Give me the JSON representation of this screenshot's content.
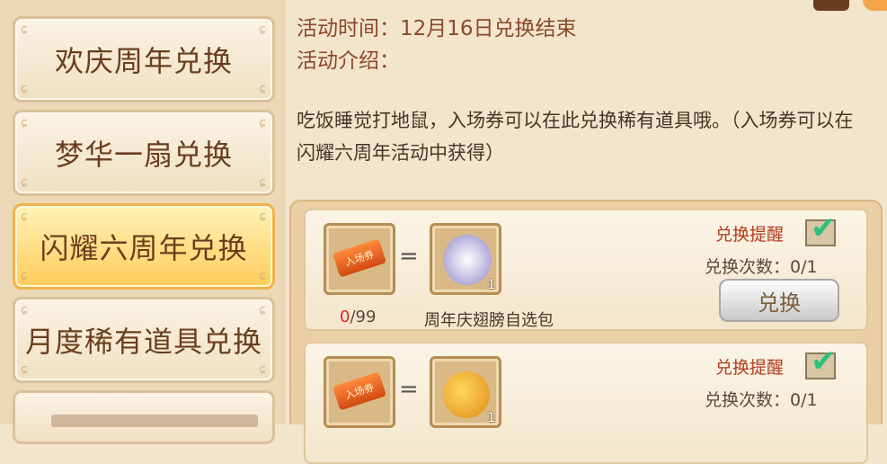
{
  "tabs": [
    {
      "label": "欢庆周年兑换",
      "active": false
    },
    {
      "label": "梦华一扇兑换",
      "active": false
    },
    {
      "label": "闪耀六周年兑换",
      "active": true
    },
    {
      "label": "月度稀有道具兑换",
      "active": false
    }
  ],
  "activity": {
    "time_label": "活动时间：12月16日兑换结束",
    "intro_label": "活动介绍：",
    "description": "吃饭睡觉打地鼠，入场券可以在此兑换稀有道具哦。（入场券可以在闪耀六周年活动中获得）"
  },
  "exchanges": [
    {
      "cost_item_text": "入场券",
      "owned": "0",
      "required": "/99",
      "equals": "=",
      "reward_name": "周年庆翅膀自选包",
      "reward_qty": "1",
      "remind_label": "兑换提醒",
      "remind_checked": true,
      "times_label": "兑换次数：0/1",
      "button_label": "兑换",
      "reward_icon": "wings-icon"
    },
    {
      "cost_item_text": "入场券",
      "equals": "=",
      "reward_qty": "1",
      "remind_label": "兑换提醒",
      "remind_checked": true,
      "times_label": "兑换次数：0/1",
      "reward_icon": "money-bag-icon"
    }
  ],
  "icons": {
    "check": "✔",
    "corner_curl": "ɕ"
  },
  "colors": {
    "active_tab": "#ffcd5a",
    "count_red": "#e0211e",
    "check_green": "#2ec07a"
  }
}
